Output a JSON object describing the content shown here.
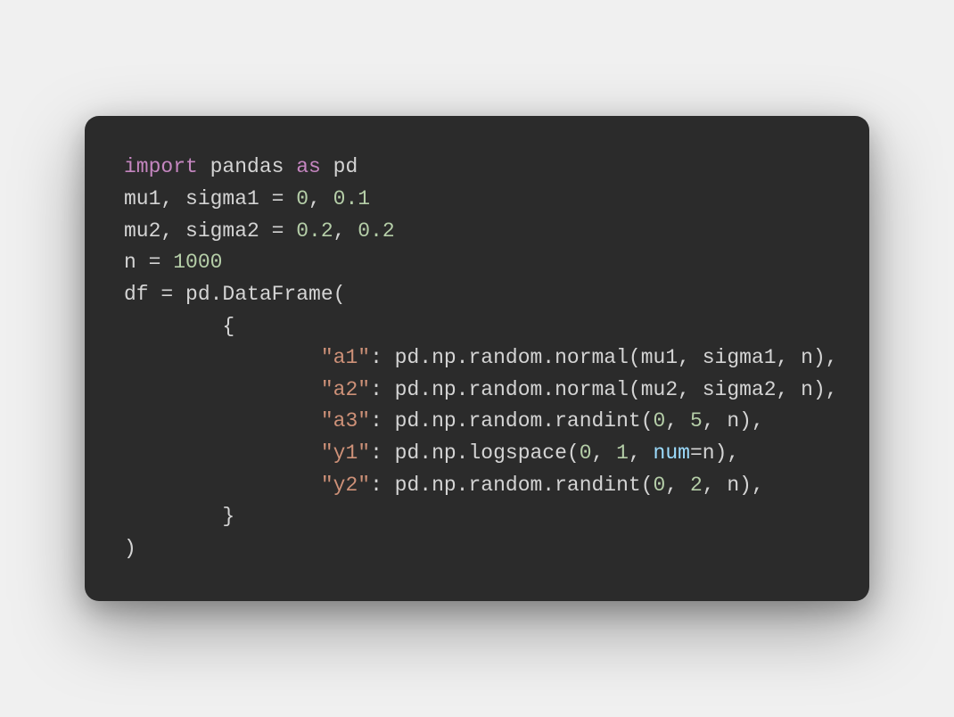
{
  "code": {
    "line1": {
      "kw1": "import",
      "mod": " pandas ",
      "kw2": "as",
      "alias": " pd"
    },
    "line2": {
      "pre": "mu1, sigma1 = ",
      "n1": "0",
      "sep": ", ",
      "n2": "0.1"
    },
    "line3": {
      "pre": "mu2, sigma2 = ",
      "n1": "0.2",
      "sep": ", ",
      "n2": "0.2"
    },
    "line4": {
      "pre": "n = ",
      "n1": "1000"
    },
    "line5": "df = pd.DataFrame(",
    "line6": "        {",
    "line7": {
      "indent": "                ",
      "key": "\"a1\"",
      "mid": ": pd.np.random.normal(mu1, sigma1, n),"
    },
    "line8": {
      "indent": "                ",
      "key": "\"a2\"",
      "mid": ": pd.np.random.normal(mu2, sigma2, n),"
    },
    "line9": {
      "indent": "                ",
      "key": "\"a3\"",
      "mid1": ": pd.np.random.randint(",
      "n1": "0",
      "sep1": ", ",
      "n2": "5",
      "mid2": ", n),"
    },
    "line10": {
      "indent": "                ",
      "key": "\"y1\"",
      "mid1": ": pd.np.logspace(",
      "n1": "0",
      "sep1": ", ",
      "n2": "1",
      "sep2": ", ",
      "param": "num",
      "mid2": "=n),"
    },
    "line11": {
      "indent": "                ",
      "key": "\"y2\"",
      "mid1": ": pd.np.random.randint(",
      "n1": "0",
      "sep1": ", ",
      "n2": "2",
      "mid2": ", n),"
    },
    "line12": "        }",
    "line13": ")"
  }
}
